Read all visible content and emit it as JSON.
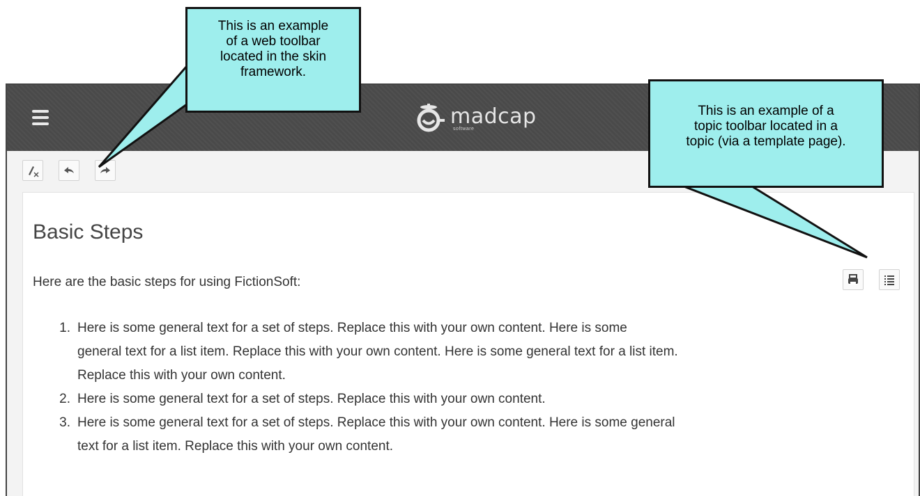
{
  "header": {
    "logo_word": "madcap",
    "logo_sub": "software"
  },
  "web_toolbar": {
    "buttons": [
      "clear-highlight-icon",
      "back-arrow-icon",
      "forward-arrow-icon"
    ]
  },
  "topic": {
    "title": "Basic Steps",
    "intro": "Here are the basic steps for using FictionSoft:",
    "topic_toolbar": [
      "print-icon",
      "list-icon"
    ],
    "steps": [
      {
        "num": "1.",
        "lines": [
          "Here is some general text for a set of steps. Replace this with your own content. Here is some",
          "general text for a list item. Replace this with your own content. Here is some general text for a list item.",
          "Replace this with your own content."
        ]
      },
      {
        "num": "2.",
        "lines": [
          "Here is some general text for a set of steps. Replace this with your own content."
        ]
      },
      {
        "num": "3.",
        "lines": [
          "Here is some general text for a set of steps. Replace this with your own content. Here is some general",
          "text for a list item. Replace this with your own content."
        ]
      }
    ]
  },
  "callouts": {
    "web_toolbar": [
      "This is an example",
      "of a web toolbar",
      "located in the skin",
      "framework."
    ],
    "topic_toolbar": [
      "This is an example of a",
      "topic toolbar located in a",
      "topic (via a template page)."
    ]
  },
  "colors": {
    "header_bg": "#4a4a4a",
    "callout_bg": "#9eeeed",
    "callout_border": "#111111"
  }
}
